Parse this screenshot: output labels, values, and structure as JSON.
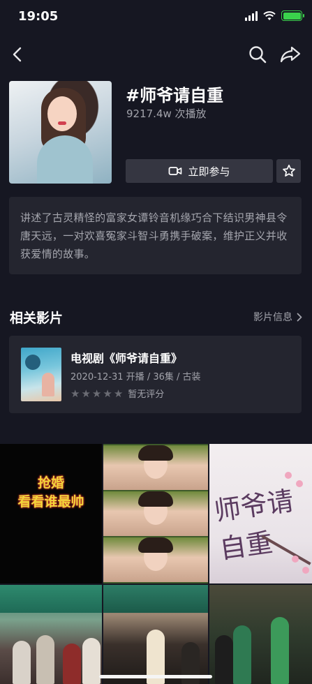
{
  "status_bar": {
    "time": "19:05"
  },
  "nav": {
    "back_icon": "chevron-left-icon",
    "search_icon": "search-icon",
    "share_icon": "share-arrow-icon"
  },
  "topic": {
    "title": "#师爷请自重",
    "play_count": "9217.4w 次播放",
    "join_label": "立即参与",
    "description": "讲述了古灵精怪的富家女谭铃音机缘巧合下结识男神县令唐天远，一对欢喜冤家斗智斗勇携手破案，维护正义并收获爱情的故事。"
  },
  "related": {
    "section_title": "相关影片",
    "info_link": "影片信息",
    "film": {
      "title": "电视剧《师爷请自重》",
      "meta": "2020-12-31 开播 / 36集 / 古装",
      "rating_text": "暂无评分",
      "stars": 5
    }
  },
  "grid": {
    "cell1_caption_line1": "抢婚",
    "cell1_caption_line2": "看看谁最帅"
  },
  "colors": {
    "background": "#161722",
    "card": "#24252f",
    "button": "#353641",
    "battery": "#3ad24c"
  }
}
